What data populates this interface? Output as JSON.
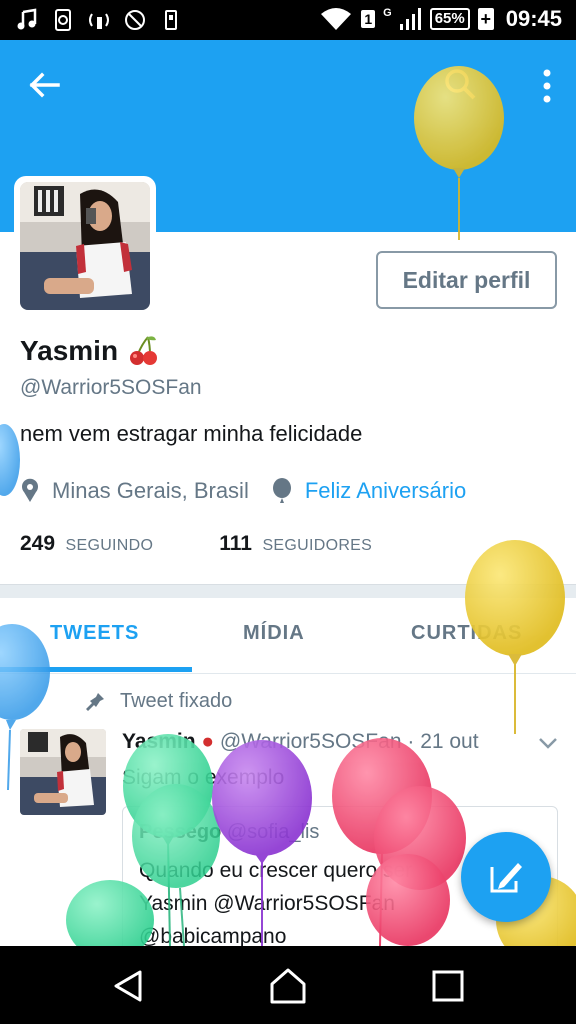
{
  "status_bar": {
    "battery": "65%",
    "battery_plus": "+",
    "time": "09:45",
    "sim_badge": "1",
    "network": "G"
  },
  "header": {
    "back_icon": "arrow-left-icon",
    "search_icon": "search-icon",
    "more_icon": "more-vert-icon",
    "banner_color": "#1da1f2"
  },
  "profile": {
    "edit_label": "Editar perfil",
    "name": "Yasmin",
    "name_emoji": "cherries-icon",
    "handle": "@Warrior5SOSFan",
    "bio": "nem vem estragar minha felicidade",
    "location": "Minas Gerais, Brasil",
    "special": "Feliz Aniversário",
    "following_count": "249",
    "following_label": "SEGUINDO",
    "followers_count": "111",
    "followers_label": "SEGUIDORES"
  },
  "tabs": [
    {
      "label": "TWEETS",
      "active": true
    },
    {
      "label": "MÍDIA",
      "active": false
    },
    {
      "label": "CURTIDAS",
      "active": false
    }
  ],
  "pinned": {
    "label": "Tweet fixado"
  },
  "tweet": {
    "name": "Yasmin",
    "handle": "@Warrior5SOSFan",
    "sep": "·",
    "date": "21 out",
    "text": "Sigam o exemplo",
    "quote": {
      "name": "Pessego",
      "handle": "@sofia_lis",
      "line1": "Quando eu crescer quero ser",
      "line2": "Yasmin @Warrior5SOSFan",
      "line3": "@babicampano"
    }
  },
  "fab": {
    "icon": "compose-tweet-icon"
  },
  "nav": {
    "back": "nav-back-icon",
    "home": "nav-home-icon",
    "recents": "nav-recents-icon"
  },
  "colors": {
    "accent": "#1da1f2",
    "muted": "#657786",
    "balloon_yellow": "#f5d33a",
    "balloon_green": "#4be0a6",
    "balloon_purple": "#a24fe3",
    "balloon_pink": "#f34d75"
  }
}
